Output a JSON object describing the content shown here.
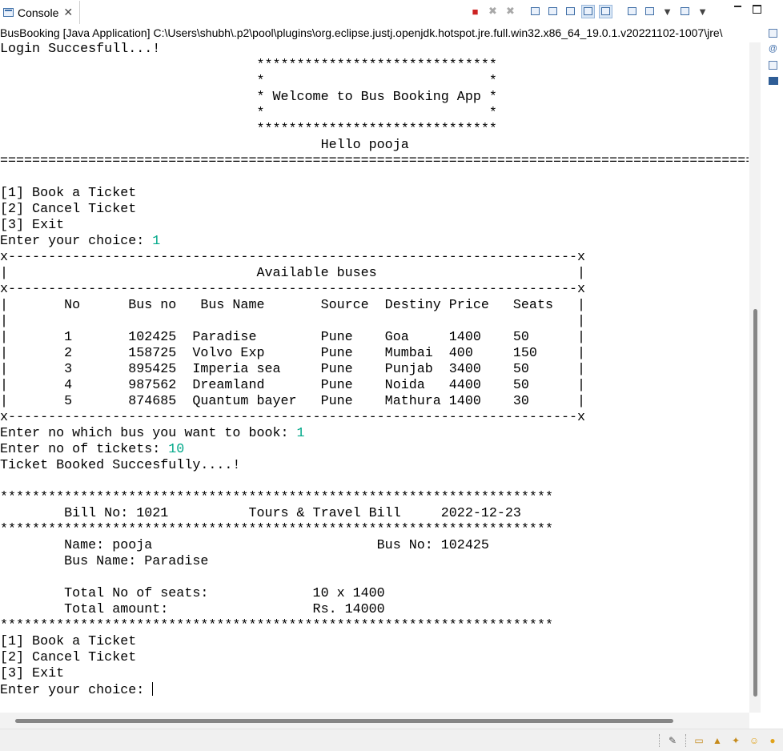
{
  "tab": {
    "label": "Console",
    "close": "✕"
  },
  "launch_description": "BusBooking [Java Application] C:\\Users\\shubh\\.p2\\pool\\plugins\\org.eclipse.justj.openjdk.hotspot.jre.full.win32.x86_64_19.0.1.v20221102-1007\\jre\\",
  "toolbar_icons": [
    "terminate-icon",
    "remove-launch-icon",
    "remove-all-terminated-icon",
    "clear-console-icon",
    "scroll-lock-icon",
    "word-wrap-icon",
    "show-on-stdout-icon",
    "show-on-stderr-icon",
    "pin-console-icon",
    "display-console-icon",
    "new-console-icon",
    "minimize-icon",
    "maximize-icon"
  ],
  "console": {
    "lines": [
      {
        "t": "Login Succesfull...!"
      },
      {
        "t": "                                ******************************"
      },
      {
        "t": "                                *                            *"
      },
      {
        "t": "                                * Welcome to Bus Booking App *"
      },
      {
        "t": "                                *                            *"
      },
      {
        "t": "                                ******************************"
      },
      {
        "t": "                                        Hello pooja"
      },
      {
        "t": "=============================================================================================="
      },
      {
        "t": ""
      },
      {
        "t": "[1] Book a Ticket"
      },
      {
        "t": "[2] Cancel Ticket"
      },
      {
        "t": "[3] Exit"
      },
      {
        "t": "Enter your choice: ",
        "input": "1"
      },
      {
        "t": "x-----------------------------------------------------------------------x"
      },
      {
        "t": "|                               Available buses                         |"
      },
      {
        "t": "x-----------------------------------------------------------------------x"
      },
      {
        "t": "|       No      Bus no   Bus Name       Source  Destiny Price   Seats   |"
      },
      {
        "t": "|                                                                       |"
      },
      {
        "t": "|       1       102425  Paradise        Pune    Goa     1400    50      |"
      },
      {
        "t": "|       2       158725  Volvo Exp       Pune    Mumbai  400     150     |"
      },
      {
        "t": "|       3       895425  Imperia sea     Pune    Punjab  3400    50      |"
      },
      {
        "t": "|       4       987562  Dreamland       Pune    Noida   4400    50      |"
      },
      {
        "t": "|       5       874685  Quantum bayer   Pune    Mathura 1400    30      |"
      },
      {
        "t": "x-----------------------------------------------------------------------x"
      },
      {
        "t": "Enter no which bus you want to book: ",
        "input": "1"
      },
      {
        "t": "Enter no of tickets: ",
        "input": "10"
      },
      {
        "t": "Ticket Booked Succesfully....!"
      },
      {
        "t": ""
      },
      {
        "t": "*********************************************************************"
      },
      {
        "t": "        Bill No: 1021          Tours & Travel Bill     2022-12-23"
      },
      {
        "t": "*********************************************************************"
      },
      {
        "t": "        Name: pooja                            Bus No: 102425"
      },
      {
        "t": "        Bus Name: Paradise"
      },
      {
        "t": ""
      },
      {
        "t": "        Total No of seats:             10 x 1400"
      },
      {
        "t": "        Total amount:                  Rs. 14000"
      },
      {
        "t": "*********************************************************************"
      },
      {
        "t": "[1] Book a Ticket"
      },
      {
        "t": "[2] Cancel Ticket"
      },
      {
        "t": "[3] Exit"
      },
      {
        "t": "Enter your choice: ",
        "caret": true
      }
    ]
  },
  "colors": {
    "input_text": "#00a889",
    "terminate": "#cc2222",
    "scroll_thumb": "#868686"
  },
  "right_trim_icons": [
    "console-view-icon",
    "javadoc-icon",
    "declaration-icon",
    "console-small-icon"
  ],
  "status_icons": [
    "open-declaration-icon",
    "book-icon",
    "graduation-cap-icon",
    "wand-icon",
    "smiley-icon",
    "lightbulb-icon"
  ]
}
